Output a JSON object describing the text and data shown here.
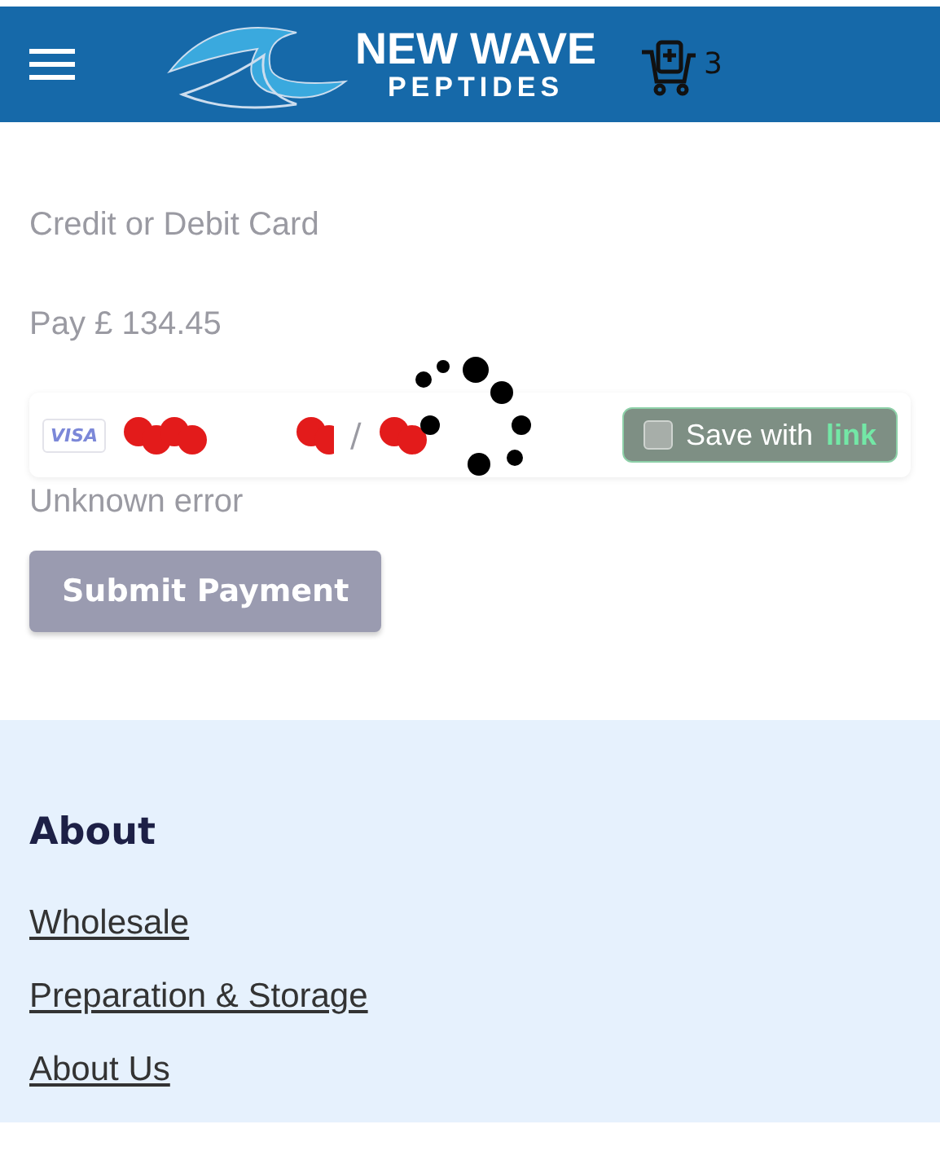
{
  "header": {
    "brand_line_1": "NEW WAVE",
    "brand_line_2": "PEPTIDES",
    "cart_count": "3"
  },
  "payment": {
    "heading": "Credit or Debit Card",
    "amount": "Pay £ 134.45",
    "card_field": {
      "brand": "VISA",
      "separator": "/",
      "loading": true
    },
    "save_link": {
      "label": "Save with",
      "brand": "link",
      "checked": false
    },
    "error": "Unknown error",
    "submit": "Submit Payment"
  },
  "footer": {
    "heading": "About",
    "links": [
      "Wholesale",
      "Preparation & Storage",
      "About Us"
    ]
  }
}
